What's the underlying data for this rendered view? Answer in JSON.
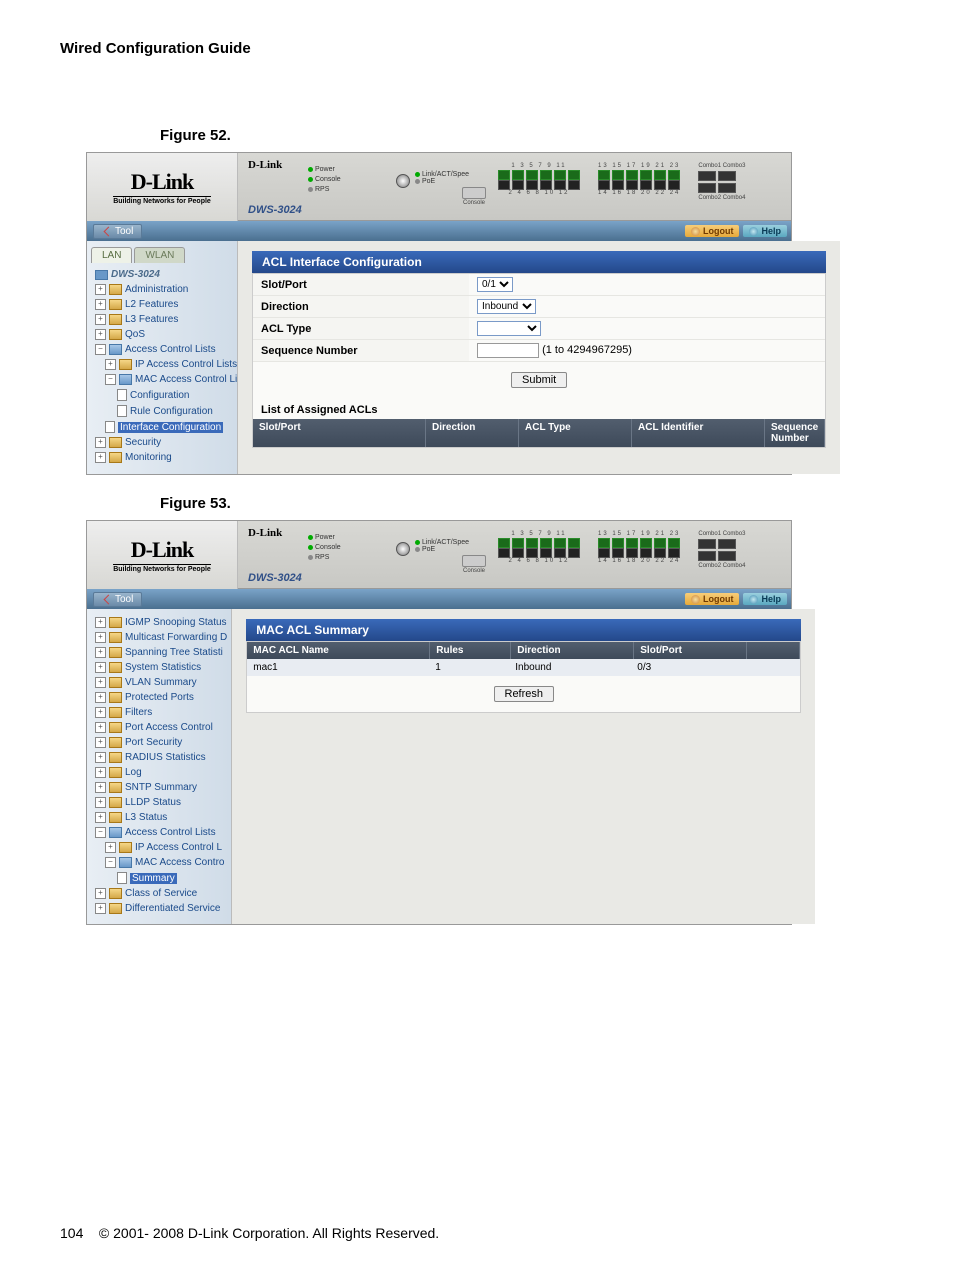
{
  "doc": {
    "header": "Wired Configuration Guide",
    "fig52": "Figure 52.",
    "fig53": "Figure 53.",
    "footer_page": "104",
    "footer_text": "© 2001- 2008 D-Link Corporation. All Rights Reserved."
  },
  "shared": {
    "logo": "D-Link",
    "tagline": "Building Networks for People",
    "brand_small": "D-Link",
    "model": "DWS-3024",
    "tool": "Tool",
    "logout": "Logout",
    "help": "Help",
    "leds": {
      "power": "Power",
      "console": "Console",
      "rps": "RPS",
      "linkact": "Link/ACT/Spee",
      "poe": "PoE"
    },
    "console_label": "Console",
    "port_top1": "1   3   5   7   9   11",
    "port_bot1": "2   4   6   8   10  12",
    "port_top2": "13  15  17  19  21  23",
    "port_bot2": "14  16  18  20  22  24",
    "combo1": "Combo1 Combo3",
    "combo2": "Combo2 Combo4"
  },
  "fig52": {
    "tabs": {
      "lan": "LAN",
      "wlan": "WLAN"
    },
    "nav": {
      "root": "DWS-3024",
      "admin": "Administration",
      "l2": "L2 Features",
      "l3": "L3 Features",
      "qos": "QoS",
      "acl": "Access Control Lists",
      "ipacl": "IP Access Control Lists",
      "macacl": "MAC Access Control Lists",
      "config": "Configuration",
      "ruleconf": "Rule Configuration",
      "ifconf": "Interface Configuration",
      "security": "Security",
      "monitoring": "Monitoring"
    },
    "panel": {
      "title": "ACL Interface Configuration",
      "fields": {
        "slotport": "Slot/Port",
        "slotport_val": "0/1",
        "direction": "Direction",
        "direction_val": "Inbound",
        "acltype": "ACL Type",
        "seqnum": "Sequence Number",
        "seqhint": "(1 to 4294967295)"
      },
      "submit": "Submit",
      "list_label": "List of Assigned ACLs",
      "cols": {
        "slotport": "Slot/Port",
        "direction": "Direction",
        "acltype": "ACL Type",
        "aclid": "ACL Identifier",
        "seqnum": "Sequence Number"
      }
    }
  },
  "fig53": {
    "nav": {
      "igmp": "IGMP Snooping Status",
      "mfwd": "Multicast Forwarding D",
      "stp": "Spanning Tree Statisti",
      "sysstat": "System Statistics",
      "vlan": "VLAN Summary",
      "pports": "Protected Ports",
      "filters": "Filters",
      "pac": "Port Access Control",
      "psec": "Port Security",
      "radius": "RADIUS Statistics",
      "log": "Log",
      "sntp": "SNTP Summary",
      "lldp": "LLDP Status",
      "l3": "L3 Status",
      "acl": "Access Control Lists",
      "ipacl": "IP Access Control L",
      "macacl": "MAC Access Contro",
      "summary": "Summary",
      "cos": "Class of Service",
      "diff": "Differentiated Service"
    },
    "panel": {
      "title": "MAC ACL Summary",
      "cols": {
        "name": "MAC ACL Name",
        "rules": "Rules",
        "direction": "Direction",
        "slotport": "Slot/Port"
      },
      "row": {
        "name": "mac1",
        "rules": "1",
        "direction": "Inbound",
        "slotport": "0/3"
      },
      "refresh": "Refresh"
    }
  }
}
